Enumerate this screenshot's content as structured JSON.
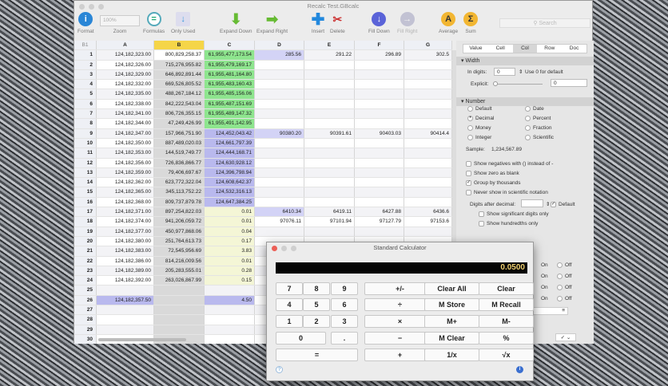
{
  "window": {
    "title": "Recalc Test.GBcalc"
  },
  "toolbar": {
    "format": "Format",
    "zoom_value": "100%",
    "zoom": "Zoom",
    "formulas": "Formulas",
    "only_used": "Only Used",
    "expand_down": "Expand Down",
    "expand_right": "Expand Right",
    "insert": "Insert",
    "delete": "Delete",
    "fill_down": "Fill Down",
    "fill_right": "Fill Right",
    "average": "Average",
    "sum": "Sum",
    "search_placeholder": "Search"
  },
  "grid": {
    "cell_ref": "B1",
    "columns": [
      "A",
      "B",
      "C",
      "D",
      "E",
      "F",
      "G"
    ],
    "rows": [
      [
        "124,182,323.00",
        "800,829,258.37",
        "61,955,477,173.54",
        "285.56",
        "291.22",
        "296.89",
        "302.5"
      ],
      [
        "124,182,326.00",
        "715,276,955.82",
        "61,955,479,169.17",
        "",
        "",
        "",
        ""
      ],
      [
        "124,182,329.00",
        "646,892,891.44",
        "61,955,481,164.80",
        "",
        "",
        "",
        ""
      ],
      [
        "124,182,332.00",
        "669,526,805.52",
        "61,955,483,160.43",
        "",
        "",
        "",
        ""
      ],
      [
        "124,182,335.00",
        "488,267,184.12",
        "61,955,485,156.06",
        "",
        "",
        "",
        ""
      ],
      [
        "124,182,338.00",
        "842,222,543.04",
        "61,955,487,151.69",
        "",
        "",
        "",
        ""
      ],
      [
        "124,182,341.00",
        "806,726,355.15",
        "61,955,489,147.32",
        "",
        "",
        "",
        ""
      ],
      [
        "124,182,344.00",
        "47,249,426.99",
        "61,955,491,142.95",
        "",
        "",
        "",
        ""
      ],
      [
        "124,182,347.00",
        "157,966,751.90",
        "124,452,043.42",
        "90380.20",
        "90391.61",
        "90403.03",
        "90414.4"
      ],
      [
        "124,182,350.00",
        "887,489,020.03",
        "124,661,797.39",
        "",
        "",
        "",
        ""
      ],
      [
        "124,182,353.00",
        "144,519,749.77",
        "124,444,168.71",
        "",
        "",
        "",
        ""
      ],
      [
        "124,182,356.00",
        "726,836,866.77",
        "124,630,928.12",
        "",
        "",
        "",
        ""
      ],
      [
        "124,182,359.00",
        "79,406,697.67",
        "124,396,798.94",
        "",
        "",
        "",
        ""
      ],
      [
        "124,182,362.00",
        "623,772,322.04",
        "124,608,642.37",
        "",
        "",
        "",
        ""
      ],
      [
        "124,182,365.00",
        "345,113,752.22",
        "124,532,316.13",
        "",
        "",
        "",
        ""
      ],
      [
        "124,182,368.00",
        "809,737,879.78",
        "124,647,384.25",
        "",
        "",
        "",
        ""
      ],
      [
        "124,182,371.00",
        "897,254,822.03",
        "0.01",
        "6410.34",
        "6419.11",
        "6427.88",
        "6436.6"
      ],
      [
        "124,182,374.00",
        "941,206,059.72",
        "0.01",
        "97076.11",
        "97101.94",
        "97127.79",
        "97153.6"
      ],
      [
        "124,182,377.00",
        "450,977,868.06",
        "0.04",
        "",
        "",
        "",
        ""
      ],
      [
        "124,182,380.00",
        "251,764,613.73",
        "0.17",
        "",
        "",
        "",
        ""
      ],
      [
        "124,182,383.00",
        "72,545,956.69",
        "3.83",
        "",
        "",
        "",
        ""
      ],
      [
        "124,182,386.00",
        "814,216,009.56",
        "0.01",
        "",
        "",
        "",
        ""
      ],
      [
        "124,182,389.00",
        "205,283,555.01",
        "0.28",
        "",
        "",
        "",
        ""
      ],
      [
        "124,182,392.00",
        "263,026,867.99",
        "0.15",
        "",
        "",
        "",
        ""
      ],
      [
        "",
        "",
        "",
        "",
        "",
        "",
        ""
      ],
      [
        "124,182,357.50",
        "",
        "4.50",
        "",
        "",
        "",
        ""
      ],
      [
        "",
        "",
        "",
        "",
        "",
        "",
        ""
      ],
      [
        "",
        "",
        "",
        "",
        "",
        "",
        ""
      ],
      [
        "",
        "",
        "",
        "",
        "",
        "",
        ""
      ],
      [
        "",
        "",
        "",
        "",
        "",
        "",
        ""
      ]
    ]
  },
  "colors": {
    "green": "#8ee58e",
    "purple": "#b9b9ee",
    "light_purple": "#d3d3f6",
    "yellow": "#f4f6d6",
    "selected_col": "#d9d9d9",
    "display_text": "#f0d070"
  },
  "inspector": {
    "tabs": [
      "Value",
      "Cell",
      "Col",
      "Row",
      "Doc"
    ],
    "active_tab": "Col",
    "width_section": "Width",
    "in_digits_label": "In digits:",
    "in_digits_value": "0",
    "use0": "Use 0 for default",
    "explicit_label": "Explicit:",
    "explicit_value": "0",
    "number_section": "Number",
    "formats": [
      "Default",
      "Date",
      "Decimal",
      "Percent",
      "Money",
      "Fraction",
      "Integer",
      "Scientific"
    ],
    "selected_format": "Decimal",
    "sample_label": "Sample:",
    "sample_value": "1,234,567.89",
    "options": [
      {
        "label": "Show negatives with () instead of -",
        "checked": false
      },
      {
        "label": "Show zero as blank",
        "checked": false
      },
      {
        "label": "Group by thousands",
        "checked": true
      },
      {
        "label": "Never show in scientific notation",
        "checked": false
      }
    ],
    "digits_label": "Digits after decimal:",
    "default_label": "Default",
    "default_checked": true,
    "sub_options": [
      "Show significant digits only",
      "Show hundredths only"
    ],
    "on": "On",
    "off": "Off"
  },
  "calculator": {
    "title": "Standard Calculator",
    "display": "0.0500",
    "buttons": [
      "7",
      "8",
      "9",
      "+/-",
      "Clear All",
      "Clear",
      "4",
      "5",
      "6",
      "÷",
      "M Store",
      "M Recall",
      "1",
      "2",
      "3",
      "×",
      "M+",
      "M-",
      "0",
      ".",
      "−",
      "M Clear",
      "%",
      "=",
      "+",
      "1/x",
      "√x"
    ]
  }
}
